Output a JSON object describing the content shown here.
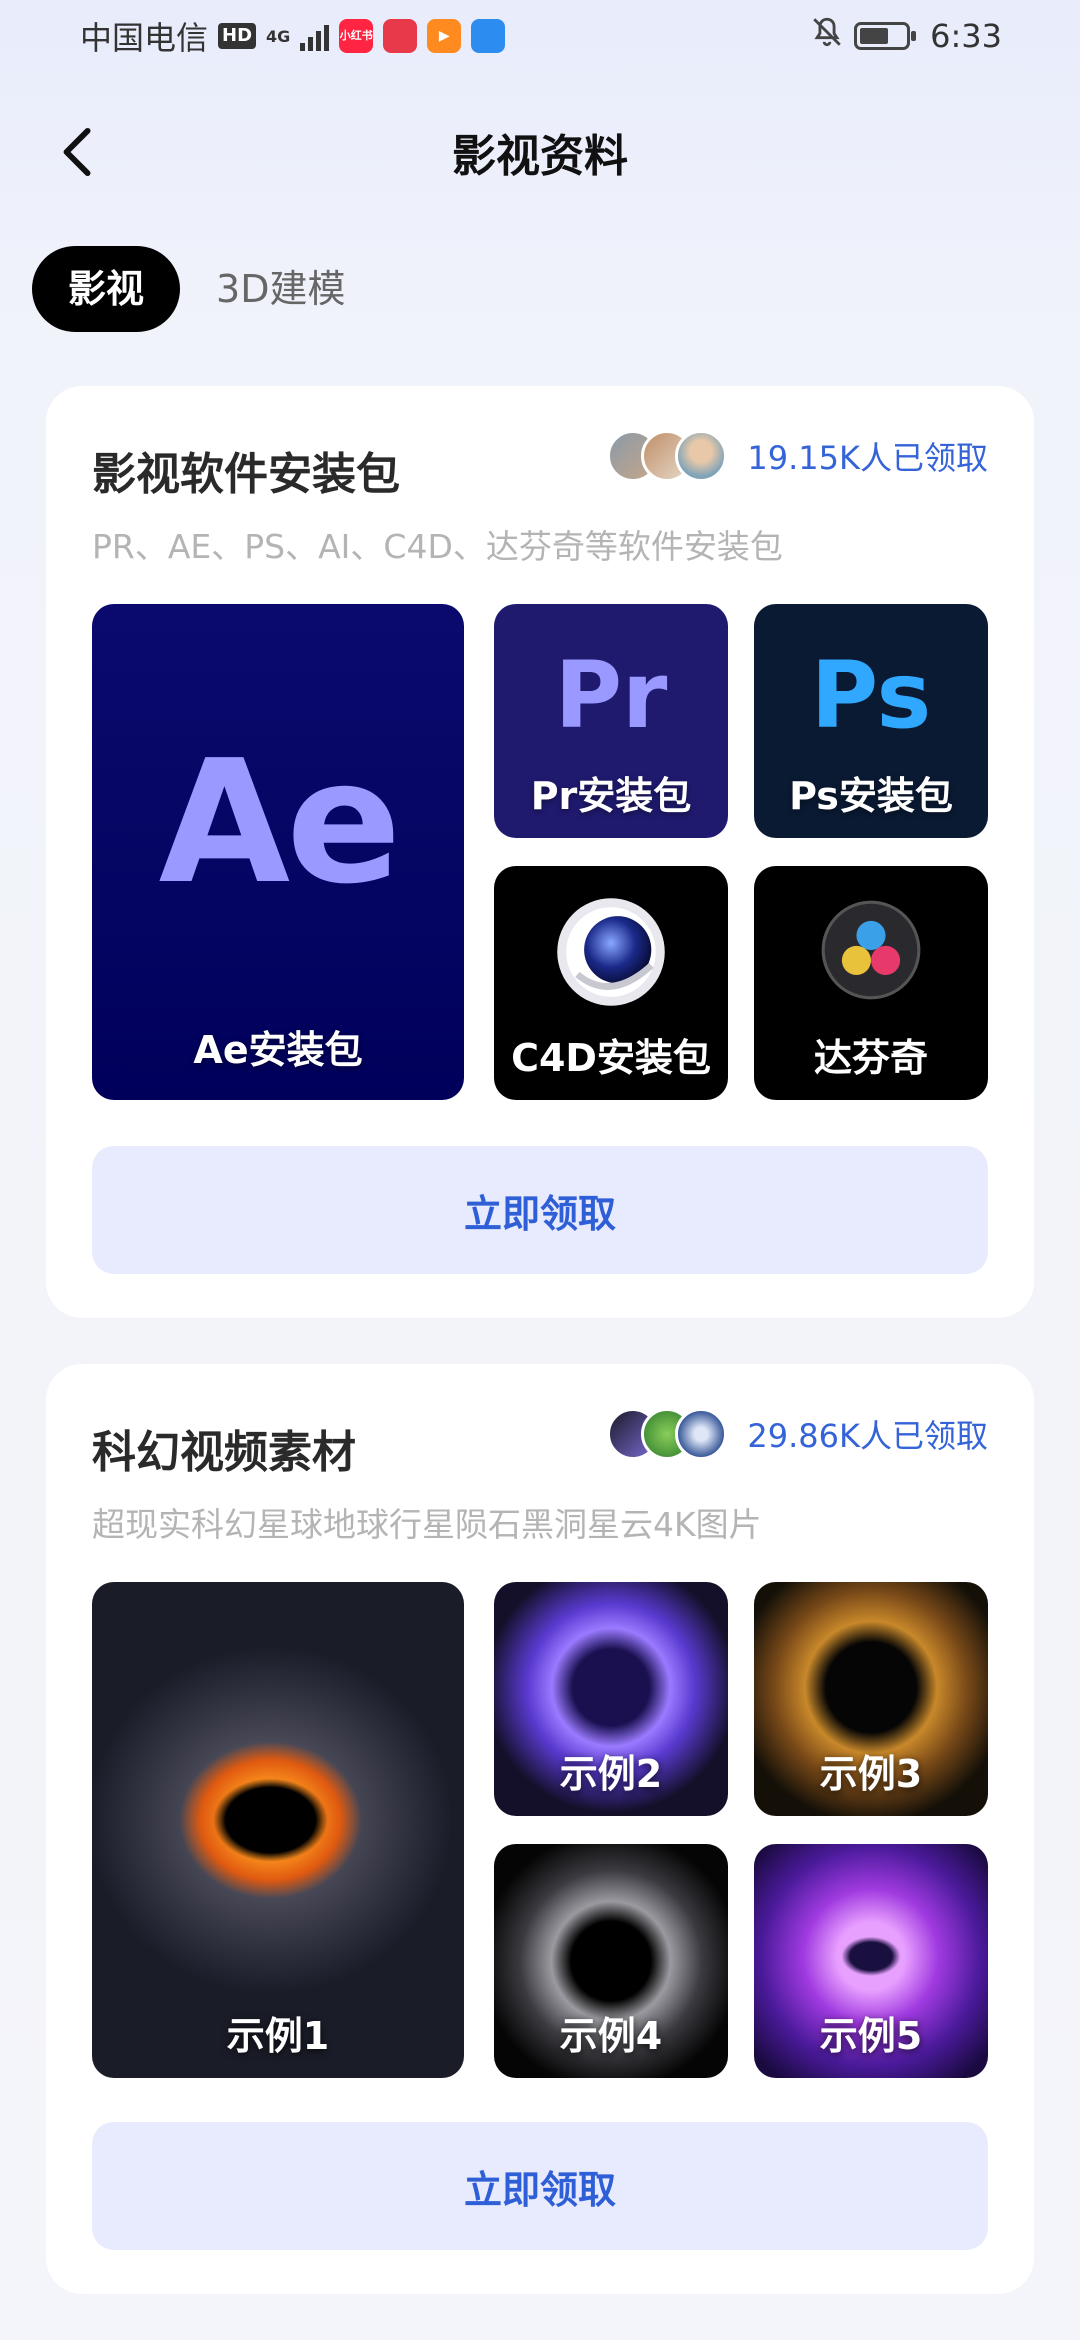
{
  "status_bar": {
    "carrier": "中国电信",
    "hd": "HD",
    "net": "4G",
    "app1": "小红书",
    "time": "6:33"
  },
  "header": {
    "title": "影视资料"
  },
  "tabs": [
    {
      "label": "影视",
      "active": true
    },
    {
      "label": "3D建模",
      "active": false
    }
  ],
  "cards": [
    {
      "title": "影视软件安装包",
      "claimed": "19.15K人已领取",
      "desc": "PR、AE、PS、AI、C4D、达芬奇等软件安装包",
      "tiles": [
        {
          "logo": "Ae",
          "label": "Ae安装包"
        },
        {
          "logo": "Pr",
          "label": "Pr安装包"
        },
        {
          "logo": "Ps",
          "label": "Ps安装包"
        },
        {
          "logo": "cinema-4d-icon",
          "label": "C4D安装包"
        },
        {
          "logo": "davinci-resolve-icon",
          "label": "达芬奇"
        }
      ],
      "button": "立即领取"
    },
    {
      "title": "科幻视频素材",
      "claimed": "29.86K人已领取",
      "desc": "超现实科幻星球地球行星陨石黑洞星云4K图片",
      "tiles": [
        {
          "label": "示例1"
        },
        {
          "label": "示例2"
        },
        {
          "label": "示例3"
        },
        {
          "label": "示例4"
        },
        {
          "label": "示例5"
        }
      ],
      "button": "立即领取"
    }
  ],
  "colors": {
    "accent": "#2f5fd6",
    "button_bg": "#e8ebfd",
    "ae_bg": "#00005b",
    "ae_logo": "#9999ff",
    "ps_logo": "#31a8ff"
  }
}
